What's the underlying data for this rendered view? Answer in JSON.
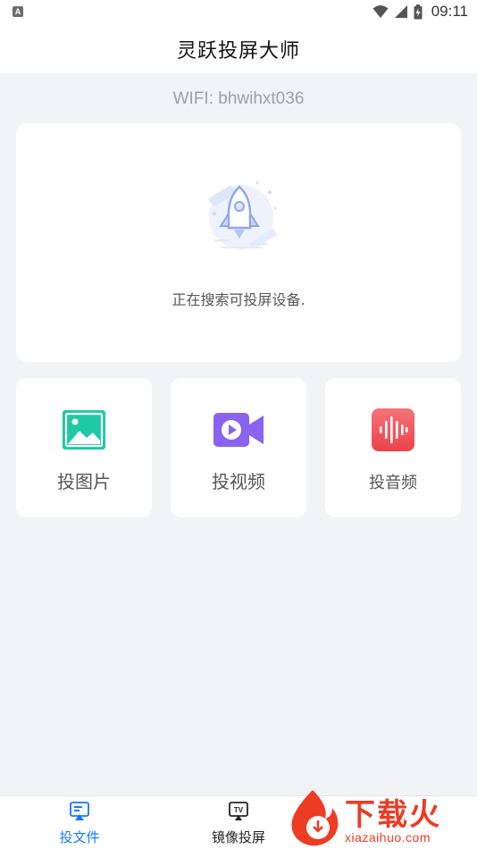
{
  "status_bar": {
    "time": "09:11",
    "left_badge": "A"
  },
  "header": {
    "title": "灵跃投屏大师"
  },
  "wifi": {
    "text": "WIFI: bhwihxt036"
  },
  "search": {
    "status_text": "正在搜索可投屏设备."
  },
  "actions": [
    {
      "label": "投图片",
      "icon": "image-icon",
      "color": "#1fc9a4"
    },
    {
      "label": "投视频",
      "icon": "video-icon",
      "color": "#8a63f0"
    },
    {
      "label": "投音频",
      "icon": "audio-icon",
      "color": "#f15a5f"
    }
  ],
  "bottom_nav": [
    {
      "label": "投文件",
      "icon": "cast-file-icon",
      "active": true
    },
    {
      "label": "镜像投屏",
      "icon": "tv-mirror-icon",
      "active": false
    }
  ],
  "watermark": {
    "text": "下载火",
    "subtext": "xiazaihuo.com"
  },
  "colors": {
    "accent": "#1677ff",
    "background": "#f2f3f5",
    "card": "#ffffff",
    "watermark": "#ee3b24"
  }
}
